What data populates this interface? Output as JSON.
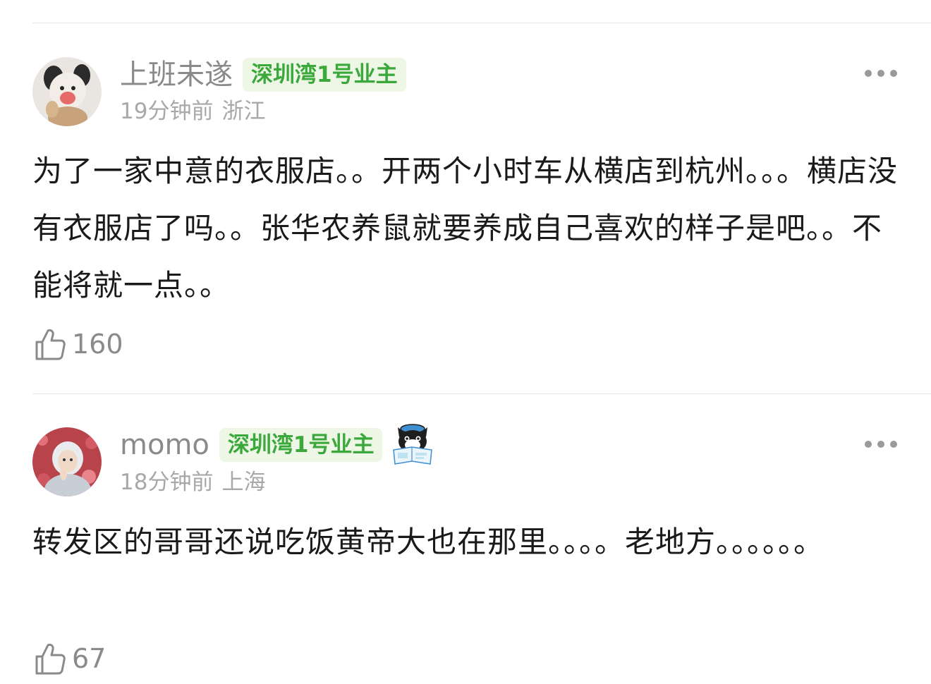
{
  "comments": [
    {
      "username": "上班未遂",
      "badge": "深圳湾1号业主",
      "time": "19分钟前",
      "location": "浙江",
      "content": "为了一家中意的衣服店。。开两个小时车从横店到杭州。。。横店没有衣服店了吗。。张华农养鼠就要养成自己喜欢的样子是吧。。不能将就一点。。",
      "likes": "160",
      "avatar_icon": "plush-toy-avatar"
    },
    {
      "username": "momo",
      "badge": "深圳湾1号业主",
      "time": "18分钟前",
      "location": "上海",
      "content": "转发区的哥哥还说吃饭黄帝大也在那里。。。。老地方。。。。。。",
      "likes": "67",
      "avatar_icon": "girl-portrait-avatar",
      "sticker_icon": "cat-reading-newspaper-sticker"
    }
  ],
  "colors": {
    "badge_bg": "#eef7e6",
    "badge_text": "#3aa83a",
    "username": "#8a8a8a",
    "meta": "#a8a8a8",
    "content": "#1a1a1a"
  }
}
